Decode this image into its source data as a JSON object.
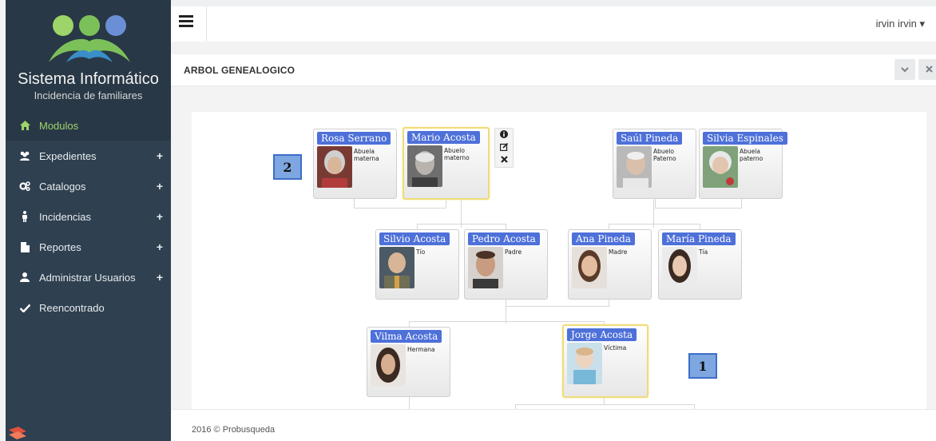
{
  "brand": {
    "title": "Sistema Informático",
    "subtitle": "Incidencia de familiares"
  },
  "sidebar": {
    "items": [
      {
        "label": "Modulos",
        "icon": "home-icon",
        "expandable": false,
        "active": true
      },
      {
        "label": "Expedientes",
        "icon": "users-icon",
        "expandable": true,
        "active": false
      },
      {
        "label": "Catalogos",
        "icon": "cogs-icon",
        "expandable": true,
        "active": false
      },
      {
        "label": "Incidencias",
        "icon": "person-icon",
        "expandable": true,
        "active": false
      },
      {
        "label": "Reportes",
        "icon": "file-icon",
        "expandable": true,
        "active": false
      },
      {
        "label": "Administrar Usuarios",
        "icon": "user-icon",
        "expandable": true,
        "active": false
      },
      {
        "label": "Reencontrado",
        "icon": "check-icon",
        "expandable": false,
        "active": false
      }
    ],
    "plus_label": "+"
  },
  "topbar": {
    "user": "irvin irvin ▾"
  },
  "panel": {
    "title": "ARBOL GENEALOGICO"
  },
  "tree": {
    "nodes": [
      {
        "name": "Rosa Serrano",
        "relation": "Abuela materna",
        "selected": false
      },
      {
        "name": "Mario Acosta",
        "relation": "Abuelo materno",
        "selected": true
      },
      {
        "name": "Saúl Pineda",
        "relation": "Abuelo Paterno",
        "selected": false
      },
      {
        "name": "Silvia Espinales",
        "relation": "Abuela paterno",
        "selected": false
      },
      {
        "name": "Silvio Acosta",
        "relation": "Tío",
        "selected": false
      },
      {
        "name": "Pedro Acosta",
        "relation": "Padre",
        "selected": false
      },
      {
        "name": "Ana Pineda",
        "relation": "Madre",
        "selected": false
      },
      {
        "name": "María Pineda",
        "relation": "Tía",
        "selected": false
      },
      {
        "name": "Vilma Acosta",
        "relation": "Hermana",
        "selected": false
      },
      {
        "name": "Jorge Acosta",
        "relation": "Víctima",
        "selected": true
      }
    ],
    "tools": [
      "info-icon",
      "edit-icon",
      "remove-icon"
    ],
    "badges": [
      "2",
      "1"
    ]
  },
  "footer": {
    "text": "2016 © Probusqueda"
  },
  "colors": {
    "sidebar": "#2f4050",
    "sidebar_dark": "#293846",
    "active_text": "#9ed56a",
    "node_name_bg": "#4e70d9",
    "badge_bg": "#7ea6e0",
    "selected_border": "#f0dc78"
  }
}
